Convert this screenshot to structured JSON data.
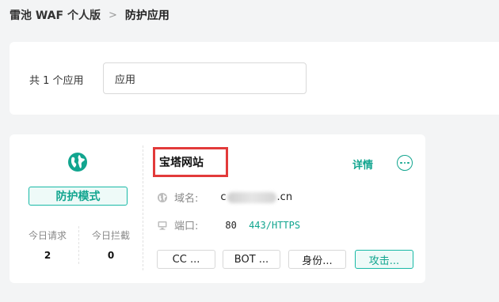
{
  "breadcrumb": {
    "root": "雷池 WAF 个人版",
    "separator": ">",
    "current": "防护应用"
  },
  "filter": {
    "count_text": "共 1 个应用",
    "search_value": "应用"
  },
  "app": {
    "icon": "globe-icon",
    "mode_label": "防护模式",
    "stats": {
      "requests_label": "今日请求",
      "requests_value": "2",
      "blocked_label": "今日拦截",
      "blocked_value": "0"
    },
    "name": "宝塔网站",
    "detail_label": "详情",
    "domain_label": "域名:",
    "domain_prefix": "c",
    "domain_suffix": ".cn",
    "port_label": "端口:",
    "port_http": "80",
    "port_https": "443/HTTPS",
    "modules": [
      "CC ...",
      "BOT ...",
      "身份...",
      "攻击..."
    ]
  },
  "colors": {
    "accent": "#12a58f",
    "highlight": "#e23a3a",
    "background": "#f3f4f5"
  }
}
